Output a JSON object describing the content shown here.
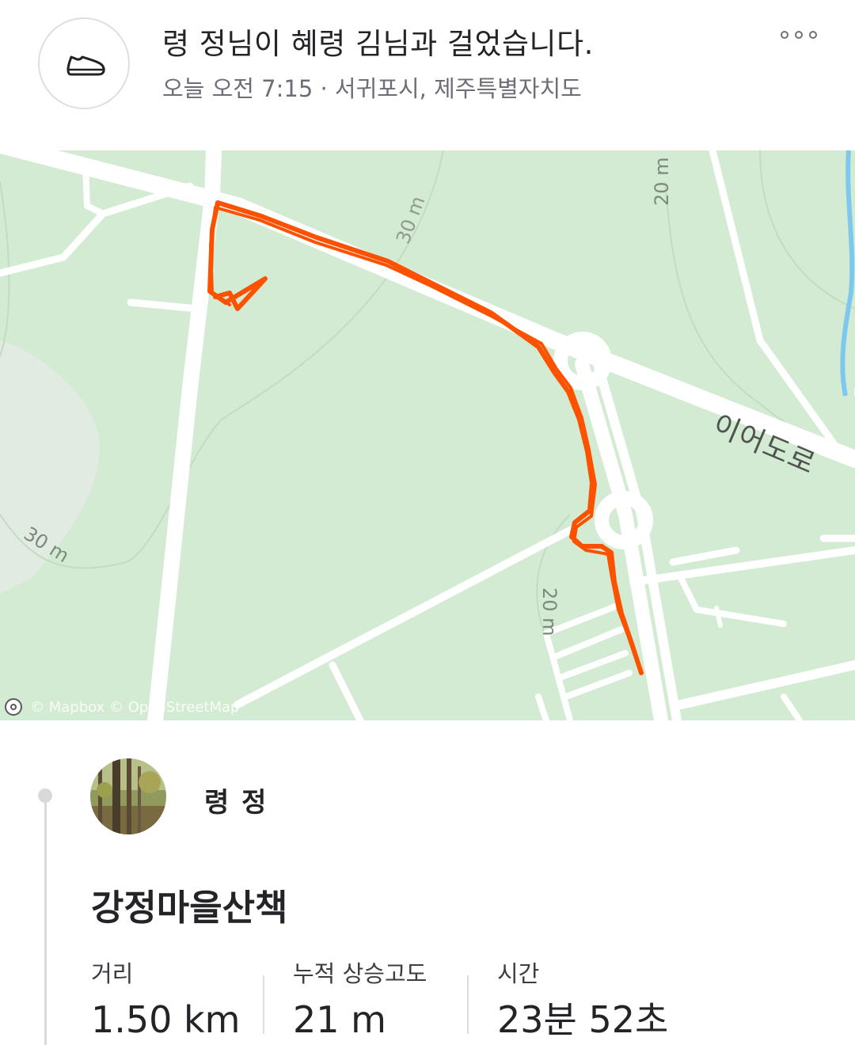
{
  "header": {
    "activity_icon": "shoe-icon",
    "title": "령 정님이 혜령 김님과 걸었습니다.",
    "meta": "오늘 오전 7:15 · 서귀포시, 제주특별자치도",
    "more_icon": "more-horizontal-icon"
  },
  "map": {
    "contour_labels": [
      "20 m",
      "30 m",
      "30 m",
      "20 m"
    ],
    "road_label": "이어도로",
    "attribution": "© Mapbox © OpenStreetMap",
    "route_color": "#fc5200",
    "land_color": "#d3ebd2",
    "water_color": "#7ec8ee"
  },
  "athlete": {
    "name": "령 정",
    "avatar": "forest-avatar"
  },
  "activity": {
    "title": "강정마을산책"
  },
  "stats": [
    {
      "label": "거리",
      "value": "1.50 km"
    },
    {
      "label": "누적 상승고도",
      "value": "21 m"
    },
    {
      "label": "시간",
      "value": "23분 52초"
    }
  ]
}
